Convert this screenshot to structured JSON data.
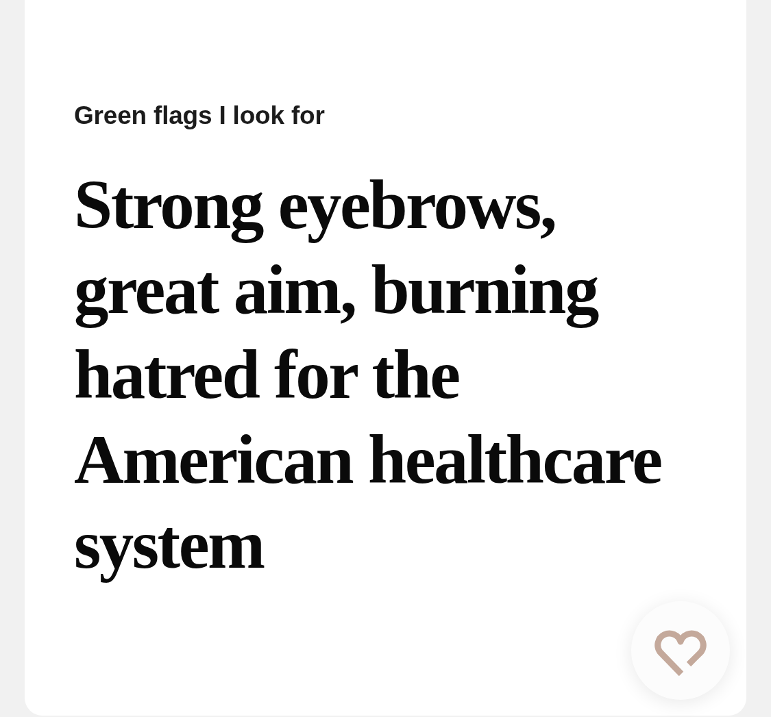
{
  "prompt": {
    "label": "Green flags I look for",
    "answer": "Strong eyebrows, great aim, burning hatred for the American healthcare system"
  }
}
